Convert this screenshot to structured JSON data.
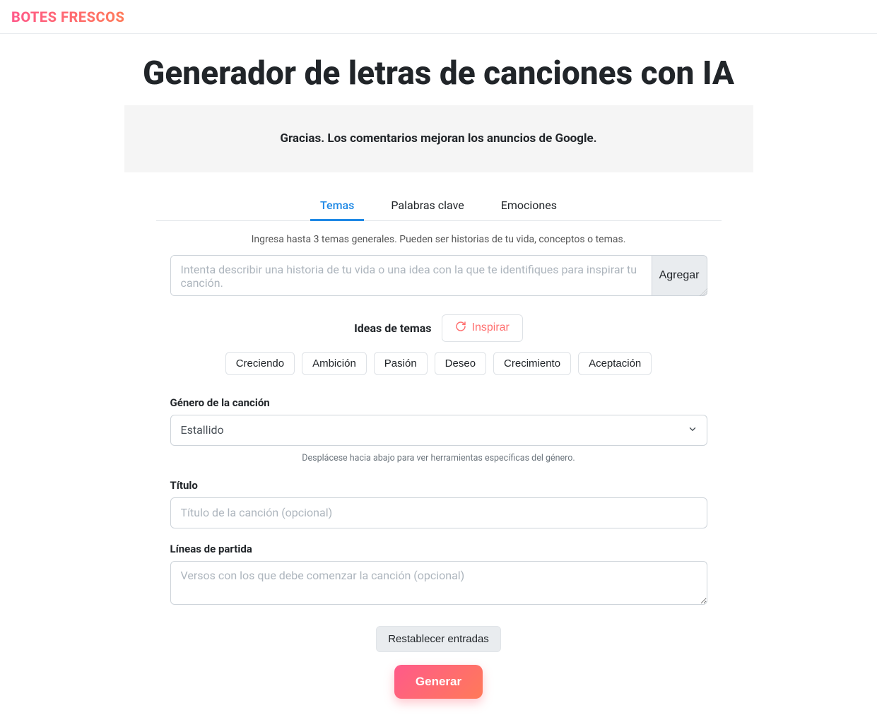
{
  "brand": "BOTES FRESCOS",
  "page_title": "Generador de letras de canciones con IA",
  "ad_message": "Gracias. Los comentarios mejoran los anuncios de Google.",
  "tabs": {
    "themes": "Temas",
    "keywords": "Palabras clave",
    "emotions": "Emociones"
  },
  "themes_instruction": "Ingresa hasta 3 temas generales. Pueden ser historias de tu vida, conceptos o temas.",
  "theme_placeholder": "Intenta describir una historia de tu vida o una idea con la que te identifiques para inspirar tu canción.",
  "add_button": "Agregar",
  "ideas_label": "Ideas de temas",
  "inspire_button": "Inspirar",
  "idea_chips": [
    "Creciendo",
    "Ambición",
    "Pasión",
    "Deseo",
    "Crecimiento",
    "Aceptación"
  ],
  "genre": {
    "label": "Género de la canción",
    "selected": "Estallido",
    "hint": "Desplácese hacia abajo para ver herramientas específicas del género."
  },
  "title": {
    "label": "Título",
    "placeholder": "Título de la canción (opcional)"
  },
  "starting": {
    "label": "Líneas de partida",
    "placeholder": "Versos con los que debe comenzar la canción (opcional)"
  },
  "reset_button": "Restablecer entradas",
  "generate_button": "Generar"
}
